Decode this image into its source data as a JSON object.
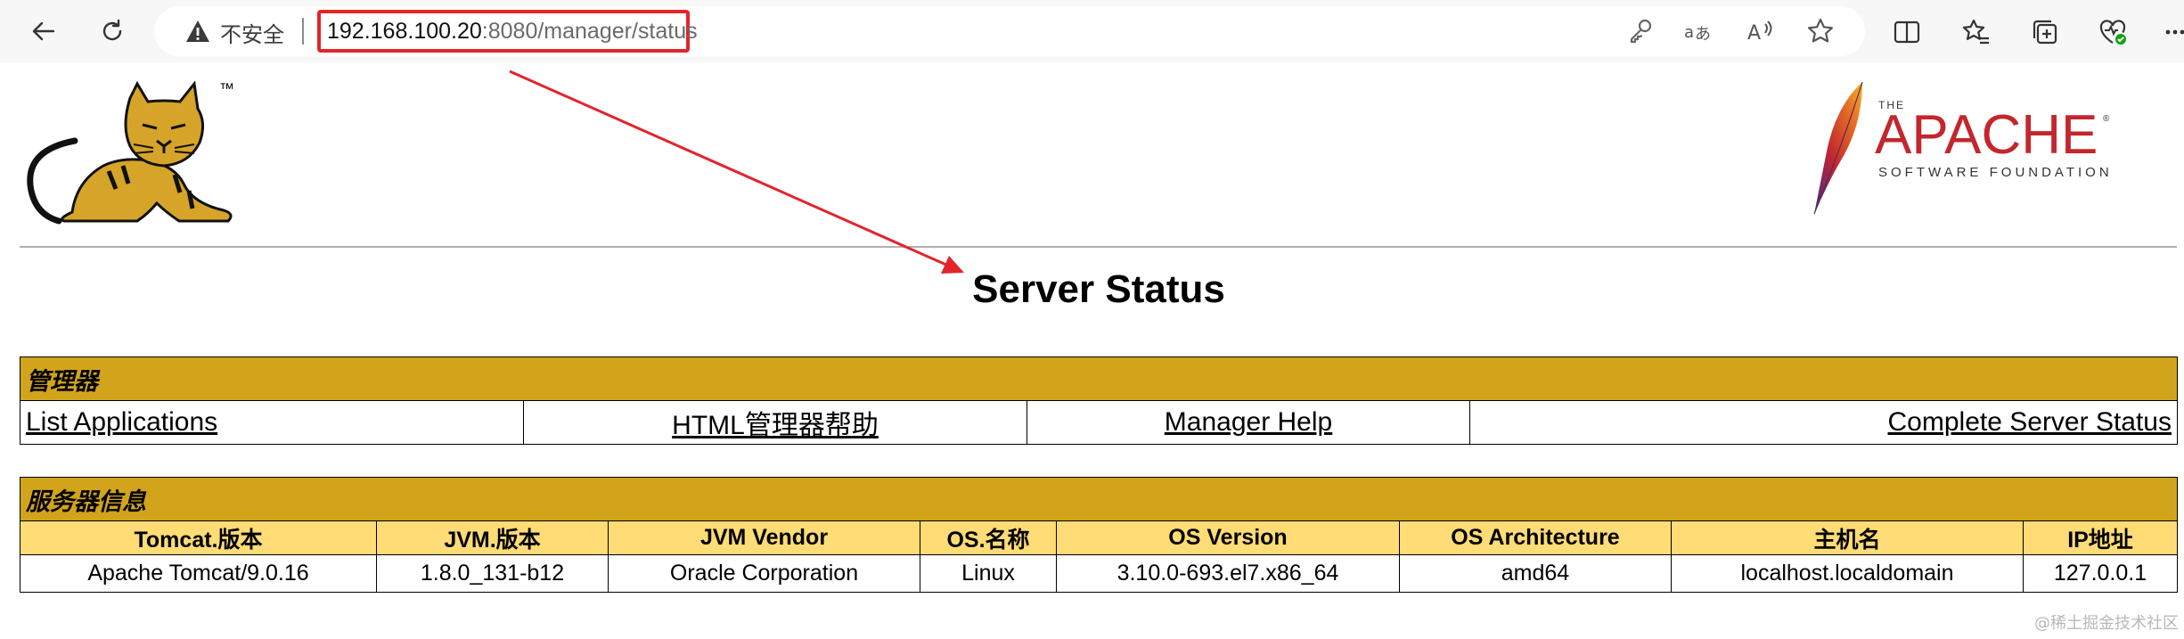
{
  "browser": {
    "security_label": "不安全",
    "url_host": "192.168.100.20",
    "url_rest": ":8080/manager/status",
    "icons": [
      "back-icon",
      "refresh-icon",
      "warning-icon",
      "key-icon",
      "translate-icon",
      "read-aloud-icon",
      "favorite-star-icon",
      "split-screen-icon",
      "favorites-icon",
      "collections-icon",
      "browser-essentials-icon",
      "more-icon"
    ]
  },
  "logos": {
    "tomcat_tm": "™"
  },
  "page": {
    "title": "Server Status"
  },
  "manager": {
    "header": "管理器",
    "links": [
      "List Applications",
      "HTML管理器帮助",
      "Manager Help",
      "Complete Server Status"
    ]
  },
  "server_info": {
    "header": "服务器信息",
    "columns": [
      "Tomcat.版本",
      "JVM.版本",
      "JVM Vendor",
      "OS.名称",
      "OS Version",
      "OS Architecture",
      "主机名",
      "IP地址"
    ],
    "values": [
      "Apache Tomcat/9.0.16",
      "1.8.0_131-b12",
      "Oracle Corporation",
      "Linux",
      "3.10.0-693.el7.x86_64",
      "amd64",
      "localhost.localdomain",
      "127.0.0.1"
    ]
  },
  "watermark": "@稀土掘金技术社区",
  "colors": {
    "header_bg": "#d2a41c",
    "column_header_bg": "#ffdc75",
    "annotation_red": "#e3242b"
  }
}
